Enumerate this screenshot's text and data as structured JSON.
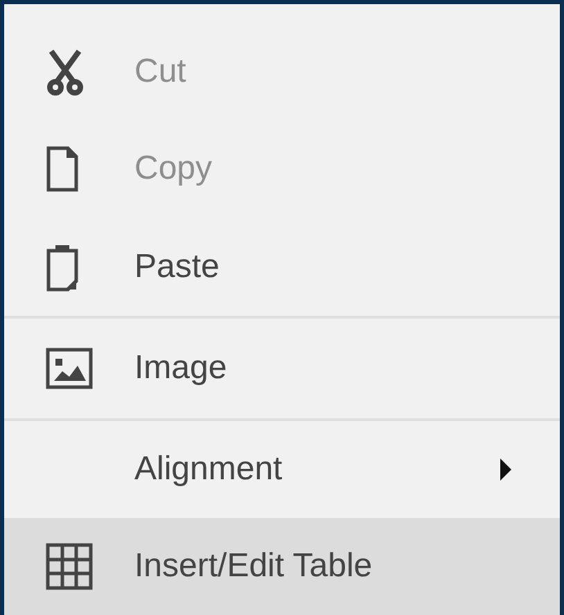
{
  "menu": {
    "items": [
      {
        "label": "Cut",
        "disabled": true,
        "selected": false,
        "divider_after": false,
        "submenu": false
      },
      {
        "label": "Copy",
        "disabled": true,
        "selected": false,
        "divider_after": false,
        "submenu": false
      },
      {
        "label": "Paste",
        "disabled": false,
        "selected": false,
        "divider_after": true,
        "submenu": false
      },
      {
        "label": "Image",
        "disabled": false,
        "selected": false,
        "divider_after": true,
        "submenu": false
      },
      {
        "label": "Alignment",
        "disabled": false,
        "selected": false,
        "divider_after": false,
        "submenu": true
      },
      {
        "label": "Insert/Edit Table",
        "disabled": false,
        "selected": true,
        "divider_after": false,
        "submenu": false
      }
    ]
  }
}
